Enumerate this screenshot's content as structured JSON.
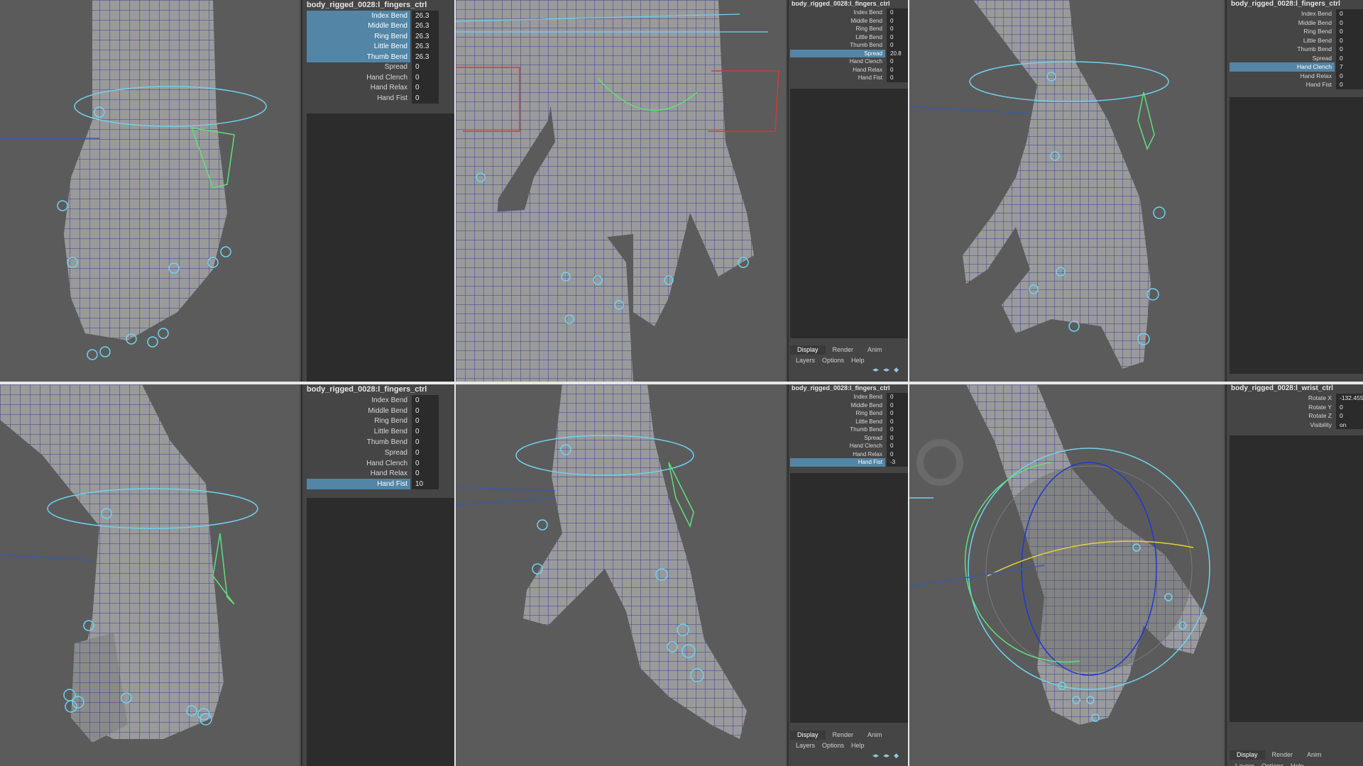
{
  "panels": [
    {
      "title": "body_rigged_0028:l_fingers_ctrl",
      "rows": [
        {
          "label": "Index Bend",
          "value": "26.3",
          "selected": true
        },
        {
          "label": "Middle Bend",
          "value": "26.3",
          "selected": true
        },
        {
          "label": "Ring Bend",
          "value": "26.3",
          "selected": true
        },
        {
          "label": "Little Bend",
          "value": "26.3",
          "selected": true
        },
        {
          "label": "Thumb Bend",
          "value": "26.3",
          "selected": true
        },
        {
          "label": "Spread",
          "value": "0",
          "selected": false
        },
        {
          "label": "Hand Clench",
          "value": "0",
          "selected": false
        },
        {
          "label": "Hand Relax",
          "value": "0",
          "selected": false
        },
        {
          "label": "Hand Fist",
          "value": "0",
          "selected": false
        }
      ]
    },
    {
      "title": "body_rigged_0028:l_fingers_ctrl",
      "rows": [
        {
          "label": "Index Bend",
          "value": "0",
          "selected": false
        },
        {
          "label": "Middle Bend",
          "value": "0",
          "selected": false
        },
        {
          "label": "Ring Bend",
          "value": "0",
          "selected": false
        },
        {
          "label": "Little Bend",
          "value": "0",
          "selected": false
        },
        {
          "label": "Thumb Bend",
          "value": "0",
          "selected": false
        },
        {
          "label": "Spread",
          "value": "20.8",
          "selected": true
        },
        {
          "label": "Hand Clench",
          "value": "0",
          "selected": false
        },
        {
          "label": "Hand Relax",
          "value": "0",
          "selected": false
        },
        {
          "label": "Hand Fist",
          "value": "0",
          "selected": false
        }
      ],
      "tabs": [
        "Display",
        "Render",
        "Anim"
      ],
      "menu": [
        "Layers",
        "Options",
        "Help"
      ]
    },
    {
      "title": "body_rigged_0028:l_fingers_ctrl",
      "rows": [
        {
          "label": "Index Bend",
          "value": "0",
          "selected": false
        },
        {
          "label": "Middle Bend",
          "value": "0",
          "selected": false
        },
        {
          "label": "Ring Bend",
          "value": "0",
          "selected": false
        },
        {
          "label": "Little Bend",
          "value": "0",
          "selected": false
        },
        {
          "label": "Thumb Bend",
          "value": "0",
          "selected": false
        },
        {
          "label": "Spread",
          "value": "0",
          "selected": false
        },
        {
          "label": "Hand Clench",
          "value": "7",
          "selected": true
        },
        {
          "label": "Hand Relax",
          "value": "0",
          "selected": false
        },
        {
          "label": "Hand Fist",
          "value": "0",
          "selected": false
        }
      ]
    },
    {
      "title": "body_rigged_0028:l_fingers_ctrl",
      "rows": [
        {
          "label": "Index Bend",
          "value": "0",
          "selected": false
        },
        {
          "label": "Middle Bend",
          "value": "0",
          "selected": false
        },
        {
          "label": "Ring Bend",
          "value": "0",
          "selected": false
        },
        {
          "label": "Little Bend",
          "value": "0",
          "selected": false
        },
        {
          "label": "Thumb Bend",
          "value": "0",
          "selected": false
        },
        {
          "label": "Spread",
          "value": "0",
          "selected": false
        },
        {
          "label": "Hand Clench",
          "value": "0",
          "selected": false
        },
        {
          "label": "Hand Relax",
          "value": "0",
          "selected": false
        },
        {
          "label": "Hand Fist",
          "value": "10",
          "selected": true
        }
      ]
    },
    {
      "title": "body_rigged_0028:l_fingers_ctrl",
      "rows": [
        {
          "label": "Index Bend",
          "value": "0",
          "selected": false
        },
        {
          "label": "Middle Bend",
          "value": "0",
          "selected": false
        },
        {
          "label": "Ring Bend",
          "value": "0",
          "selected": false
        },
        {
          "label": "Little Bend",
          "value": "0",
          "selected": false
        },
        {
          "label": "Thumb Bend",
          "value": "0",
          "selected": false
        },
        {
          "label": "Spread",
          "value": "0",
          "selected": false
        },
        {
          "label": "Hand Clench",
          "value": "0",
          "selected": false
        },
        {
          "label": "Hand Relax",
          "value": "0",
          "selected": false
        },
        {
          "label": "Hand Fist",
          "value": "-3",
          "selected": true
        }
      ],
      "tabs": [
        "Display",
        "Render",
        "Anim"
      ],
      "menu": [
        "Layers",
        "Options",
        "Help"
      ]
    },
    {
      "title": "body_rigged_0028:l_wrist_ctrl",
      "rows": [
        {
          "label": "Rotate X",
          "value": "-132.455",
          "selected": false
        },
        {
          "label": "Rotate Y",
          "value": "0",
          "selected": false
        },
        {
          "label": "Rotate Z",
          "value": "0",
          "selected": false
        },
        {
          "label": "Visibility",
          "value": "on",
          "selected": false
        }
      ],
      "tabs": [
        "Display",
        "Render",
        "Anim"
      ],
      "menu": [
        "Layers",
        "Options",
        "Help"
      ]
    }
  ],
  "colors": {
    "selected_attr": "#5285a6",
    "mesh_fill": "#9a9a9a",
    "wireframe": "#1e2a8c",
    "control_curve": "#6fd3f0",
    "control_green": "#5ee07a",
    "control_red": "#d23a3a",
    "control_yellow": "#e6d23a"
  }
}
